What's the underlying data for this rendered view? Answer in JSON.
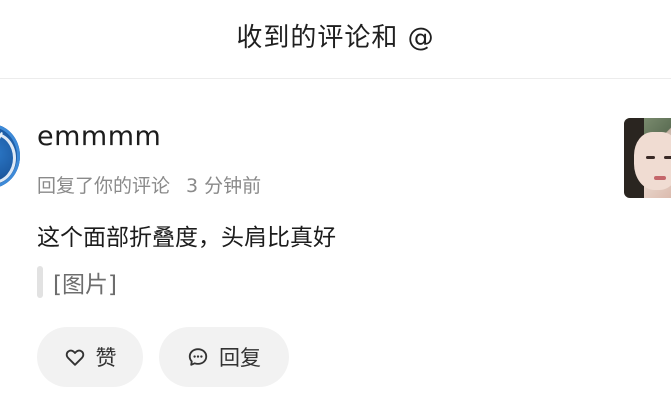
{
  "header": {
    "title": "收到的评论和 @"
  },
  "notification": {
    "username": "emmmm",
    "action": "回复了你的评论",
    "time": "3 分钟前",
    "comment": "这个面部折叠度，头肩比真好",
    "quote": "[图片]",
    "like_label": "赞",
    "reply_label": "回复"
  },
  "icons": {
    "avatar": "user-avatar",
    "like": "heart-icon",
    "reply": "chat-bubble-icon",
    "thumbnail": "post-thumbnail"
  },
  "colors": {
    "text": "#1c1c1c",
    "meta": "#8a8a8a",
    "button_bg": "#f2f2f2",
    "divider": "#ececec"
  }
}
